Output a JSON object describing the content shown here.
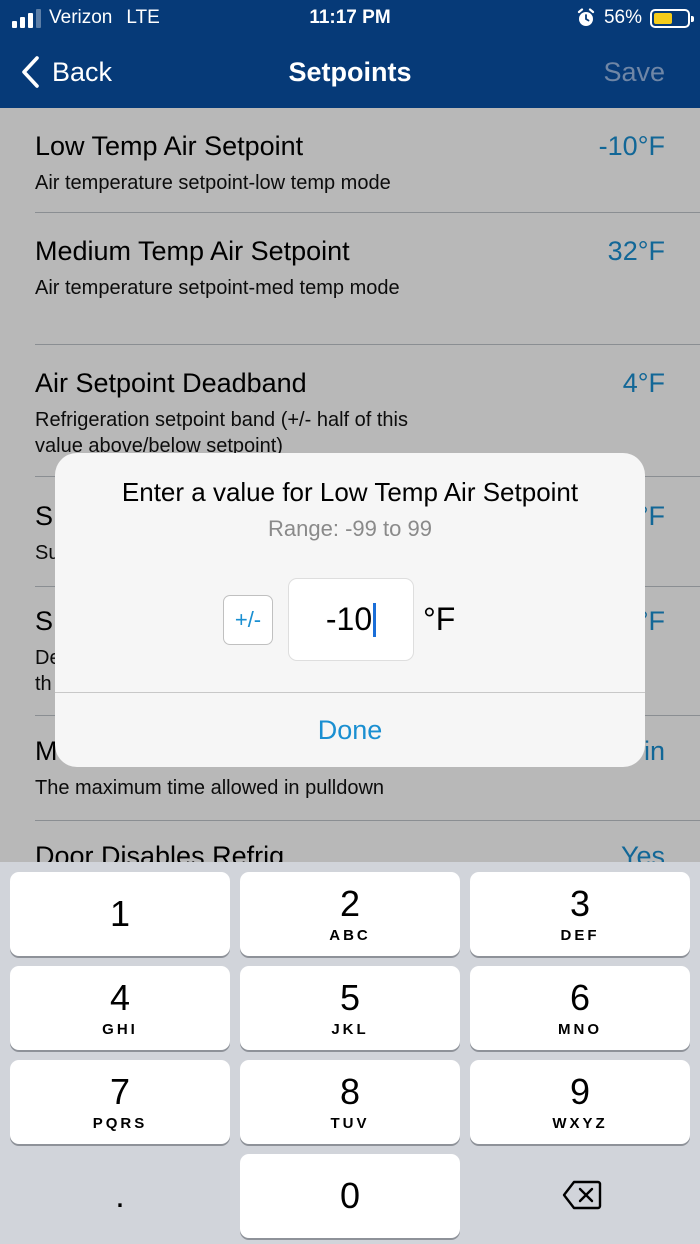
{
  "status_bar": {
    "carrier": "Verizon",
    "network": "LTE",
    "time": "11:17 PM",
    "battery_percent": "56%",
    "battery_level": 0.56,
    "battery_color": "#f5cc1a"
  },
  "nav": {
    "back_label": "Back",
    "title": "Setpoints",
    "save_label": "Save",
    "bar_color": "#063a78"
  },
  "setpoints": [
    {
      "title": "Low Temp Air Setpoint",
      "value": "-10°F",
      "subtitle": "Air temperature setpoint-low temp mode"
    },
    {
      "title": "Medium Temp Air Setpoint",
      "value": "32°F",
      "subtitle": "Air temperature setpoint-med temp mode"
    },
    {
      "title": "Air Setpoint Deadband",
      "value": "4°F",
      "subtitle": "Refrigeration setpoint band (+/- half of this value above/below setpoint)"
    },
    {
      "title": "S",
      "value": "°F",
      "subtitle": "Su"
    },
    {
      "title": "S",
      "value": "°F",
      "subtitle": "De th"
    },
    {
      "title": "M",
      "value": "in",
      "subtitle": "The maximum time allowed in pulldown"
    },
    {
      "title": "Door Disables Refrig",
      "value": "Yes",
      "subtitle": ""
    }
  ],
  "dialog": {
    "title": "Enter a value for Low Temp Air Setpoint",
    "range": "Range: -99 to 99",
    "sign_toggle_label": "+/-",
    "input_value": "-10",
    "unit": "°F",
    "done_label": "Done",
    "accent_color": "#1a8fd1"
  },
  "keypad": {
    "keys": [
      {
        "digit": "1",
        "letters": ""
      },
      {
        "digit": "2",
        "letters": "ABC"
      },
      {
        "digit": "3",
        "letters": "DEF"
      },
      {
        "digit": "4",
        "letters": "GHI"
      },
      {
        "digit": "5",
        "letters": "JKL"
      },
      {
        "digit": "6",
        "letters": "MNO"
      },
      {
        "digit": "7",
        "letters": "PQRS"
      },
      {
        "digit": "8",
        "letters": "TUV"
      },
      {
        "digit": "9",
        "letters": "WXYZ"
      },
      {
        "digit": "0",
        "letters": ""
      }
    ],
    "decimal_label": ".",
    "delete_icon": "backspace-icon"
  }
}
